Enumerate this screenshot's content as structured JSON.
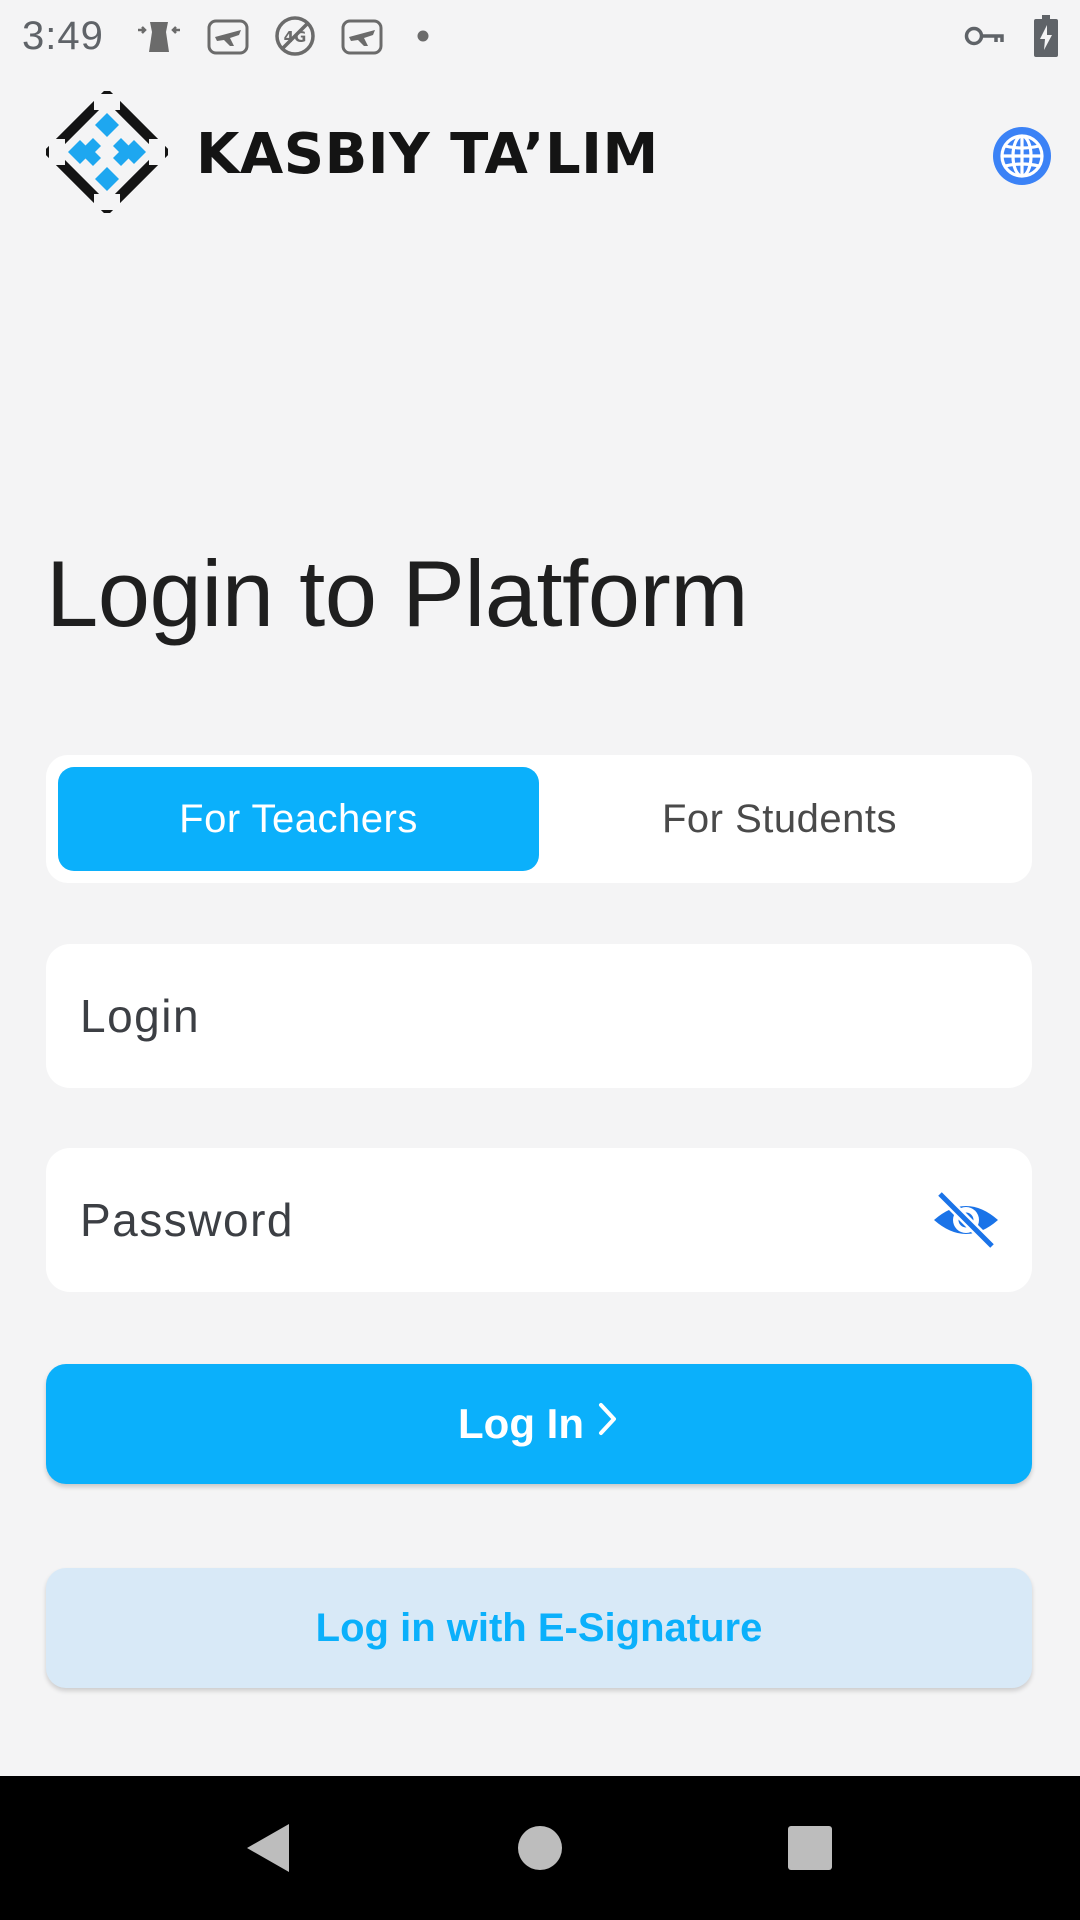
{
  "status_bar": {
    "time": "3:49",
    "icons_left": [
      "alarm-app-icon",
      "plane-app-icon",
      "no-4g-icon",
      "plane-app-icon",
      "notification-dot-icon"
    ],
    "icons_right": [
      "vpn-key-icon",
      "battery-charging-icon"
    ]
  },
  "header": {
    "brand": "KASBIY TA’LIM",
    "logo_colors": {
      "dark": "#141414",
      "accent": "#1ea7f0"
    },
    "language_icon": "globe-icon",
    "language_icon_color": "#3b82f6"
  },
  "main": {
    "title": "Login to Platform",
    "tabs": [
      {
        "label": "For Teachers",
        "active": true
      },
      {
        "label": "For Students",
        "active": false
      }
    ],
    "login_field": {
      "placeholder": "Login",
      "value": ""
    },
    "password_field": {
      "placeholder": "Password",
      "value": "",
      "toggle_icon": "eye-off-icon"
    },
    "login_button": {
      "label": "Log In",
      "icon": "chevron-right-icon"
    },
    "esign_button": {
      "label": "Log in with E-Signature"
    }
  },
  "colors": {
    "primary": "#0bb0fb",
    "secondary_bg": "#d8e9f7",
    "page_bg": "#f4f4f5",
    "icon_blue": "#1a73e8"
  },
  "nav_bar": {
    "buttons": [
      "back-icon",
      "home-icon",
      "recents-icon"
    ]
  }
}
